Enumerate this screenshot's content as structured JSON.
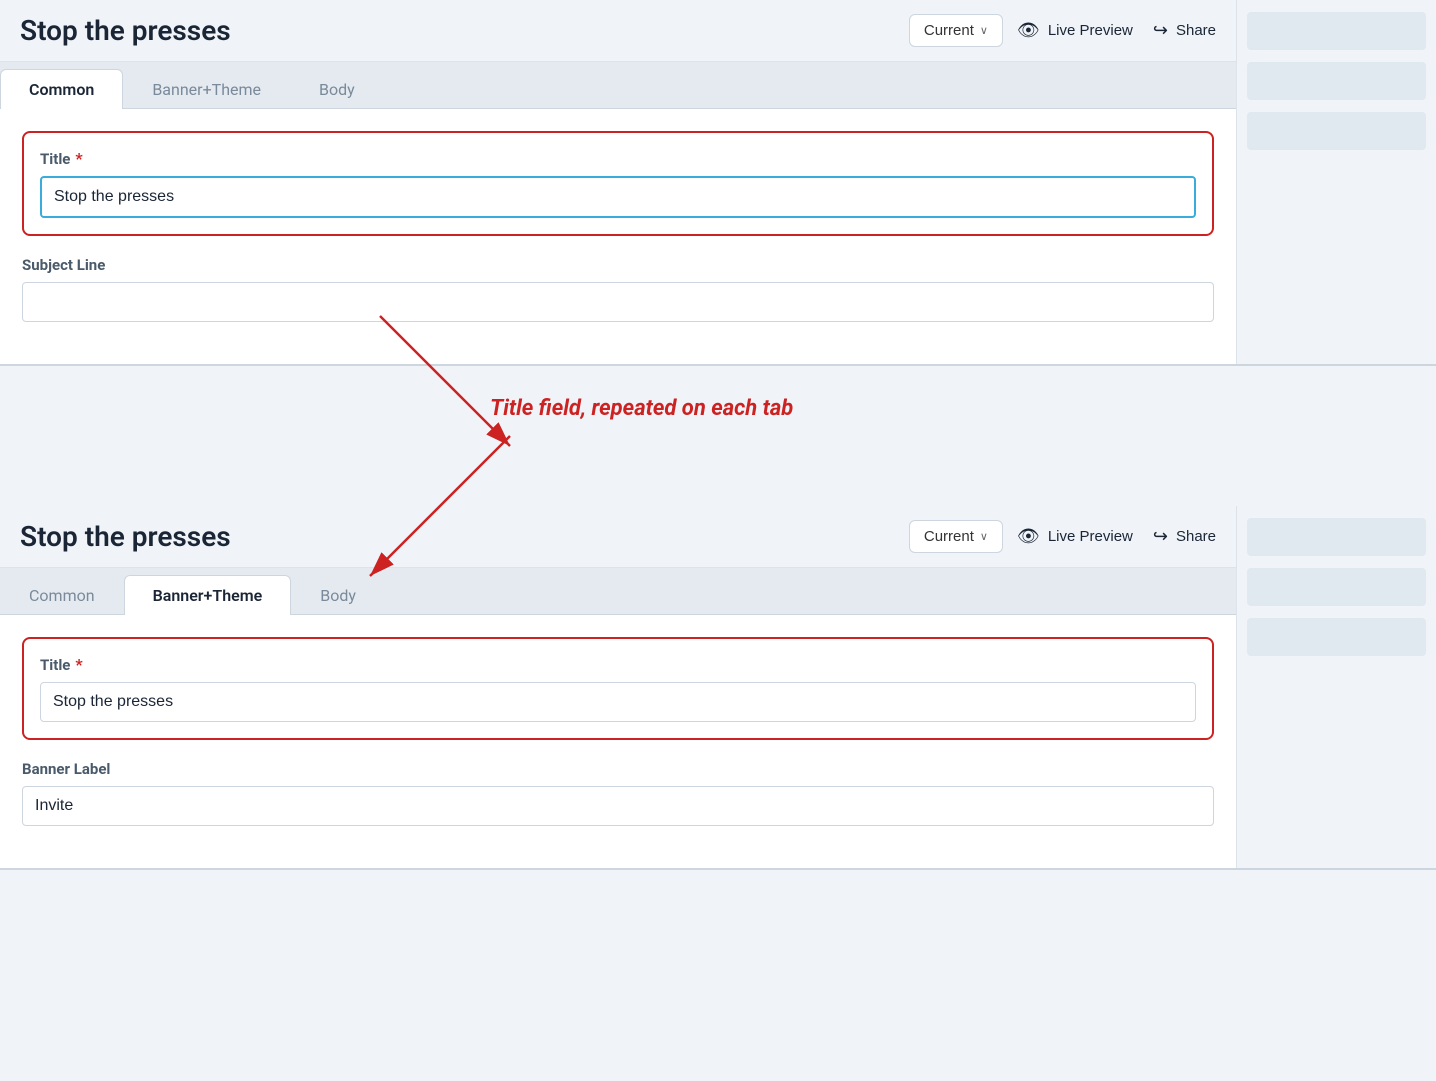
{
  "page": {
    "title": "Stop the presses"
  },
  "panel1": {
    "header": {
      "title": "Stop the presses",
      "version_label": "Current",
      "live_preview_label": "Live Preview",
      "share_label": "Share"
    },
    "tabs": [
      {
        "id": "common",
        "label": "Common",
        "active": true
      },
      {
        "id": "banner-theme",
        "label": "Banner+Theme",
        "active": false
      },
      {
        "id": "body",
        "label": "Body",
        "active": false
      }
    ],
    "form": {
      "title_label": "Title",
      "title_value": "Stop the presses",
      "subject_label": "Subject Line",
      "subject_value": ""
    }
  },
  "panel2": {
    "header": {
      "title": "Stop the presses",
      "version_label": "Current",
      "live_preview_label": "Live Preview",
      "share_label": "Share"
    },
    "tabs": [
      {
        "id": "common",
        "label": "Common",
        "active": false
      },
      {
        "id": "banner-theme",
        "label": "Banner+Theme",
        "active": true
      },
      {
        "id": "body",
        "label": "Body",
        "active": false
      }
    ],
    "form": {
      "title_label": "Title",
      "title_value": "Stop the presses",
      "banner_label": "Banner Label",
      "banner_value": "Invite"
    }
  },
  "annotation": {
    "text": "Title field, repeated on each tab"
  },
  "icons": {
    "eye": "👁",
    "share": "↪",
    "chevron_down": "∨"
  }
}
